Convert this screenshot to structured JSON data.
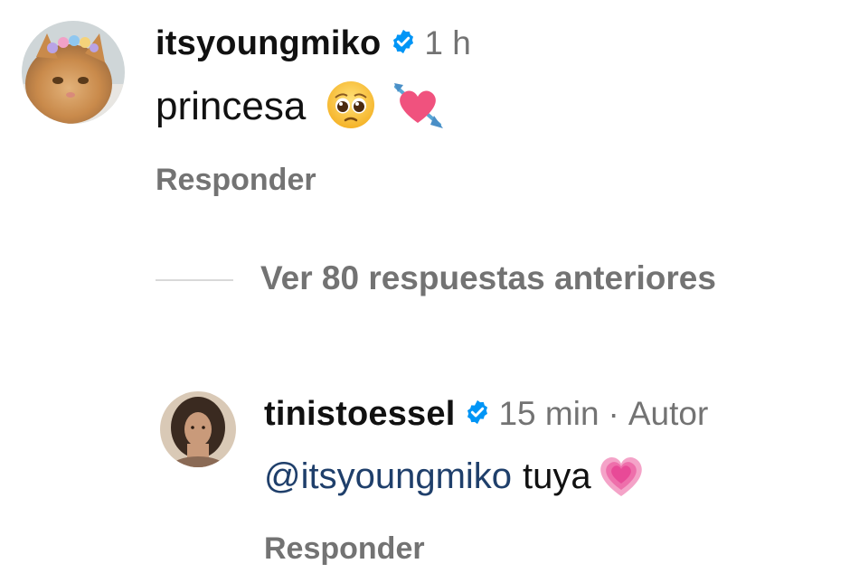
{
  "comment_1": {
    "username": "itsyoungmiko",
    "time": "1 h",
    "text": "princesa",
    "emojis": [
      "pleading-face-emoji",
      "heart-with-arrow-emoji"
    ],
    "reply_label": "Responder",
    "avatar": "cat-with-flower-crown-avatar"
  },
  "view_replies": {
    "label": "Ver 80 respuestas anteriores"
  },
  "comment_2": {
    "username": "tinistoessel",
    "time": "15 min",
    "separator": "·",
    "author_badge": "Autor",
    "mention": "@itsyoungmiko",
    "text": "tuya",
    "emojis": [
      "growing-heart-emoji"
    ],
    "reply_label": "Responder",
    "avatar": "woman-portrait-avatar"
  },
  "colors": {
    "verified_blue": "#0095f6",
    "meta_gray": "#737373",
    "mention_blue": "#1f3f6b",
    "divider": "#d9d9d9"
  }
}
